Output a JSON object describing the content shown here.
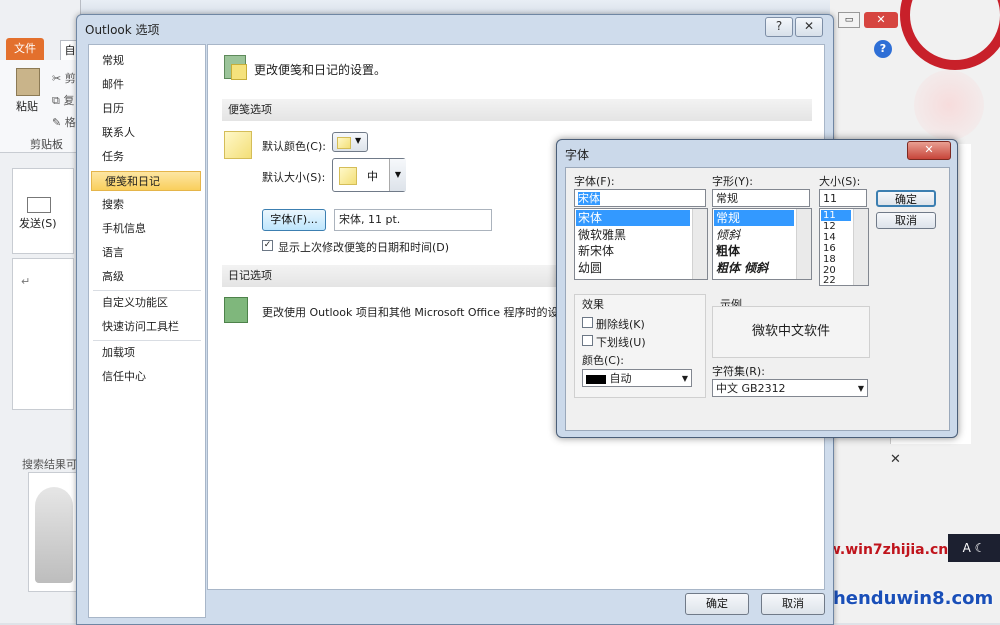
{
  "main_window": {
    "ribbon_tabs": [
      "文件",
      "自"
    ],
    "paste_label": "粘贴",
    "clipboard_group": "剪贴板",
    "send_label": "发送(S)",
    "search_results_label": "搜索结果可",
    "cut_label": "剪",
    "copy_label": "复",
    "format_label": "格"
  },
  "options_dialog": {
    "title": "Outlook 选项",
    "title_help": "?",
    "title_close": "✕",
    "nav": [
      "常规",
      "邮件",
      "日历",
      "联系人",
      "任务",
      "便笺和日记",
      "搜索",
      "手机信息",
      "语言",
      "高级",
      "自定义功能区",
      "快速访问工具栏",
      "加载项",
      "信任中心"
    ],
    "selected_nav": "便笺和日记",
    "header_text": "更改便笺和日记的设置。",
    "notes_section": "便笺选项",
    "default_color_label": "默认颜色(C):",
    "default_size_label": "默认大小(S):",
    "default_size_value": "中",
    "font_button": "字体(F)...",
    "font_value": "宋体, 11 pt.",
    "show_date_label": "显示上次修改便笺的日期和时间(D)",
    "show_date_checked": true,
    "journal_section": "日记选项",
    "journal_text": "更改使用 Outlook 项目和其他 Microsoft Office 程序时的设",
    "ok": "确定",
    "cancel": "取消"
  },
  "font_dialog": {
    "title": "字体",
    "font_label": "字体(F):",
    "font_value": "宋体",
    "fonts": [
      "宋体",
      "微软雅黑",
      "新宋体",
      "幼圆"
    ],
    "style_label": "字形(Y):",
    "style_value": "常规",
    "styles": [
      "常规",
      "倾斜",
      "粗体",
      "粗体 倾斜"
    ],
    "size_label": "大小(S):",
    "size_value": "11",
    "sizes": [
      "11",
      "12",
      "14",
      "16",
      "18",
      "20",
      "22"
    ],
    "ok": "确定",
    "cancel": "取消",
    "effects_label": "效果",
    "strikeout": "删除线(K)",
    "underline": "下划线(U)",
    "color_label": "颜色(C):",
    "color_value": "自动",
    "sample_label": "示例",
    "sample_text": "微软中文软件",
    "script_label": "字符集(R):",
    "script_value": "中文 GB2312"
  },
  "watermark": {
    "url1": "www.win7zhijia.cn",
    "url2": "Shenduwin8.com"
  }
}
